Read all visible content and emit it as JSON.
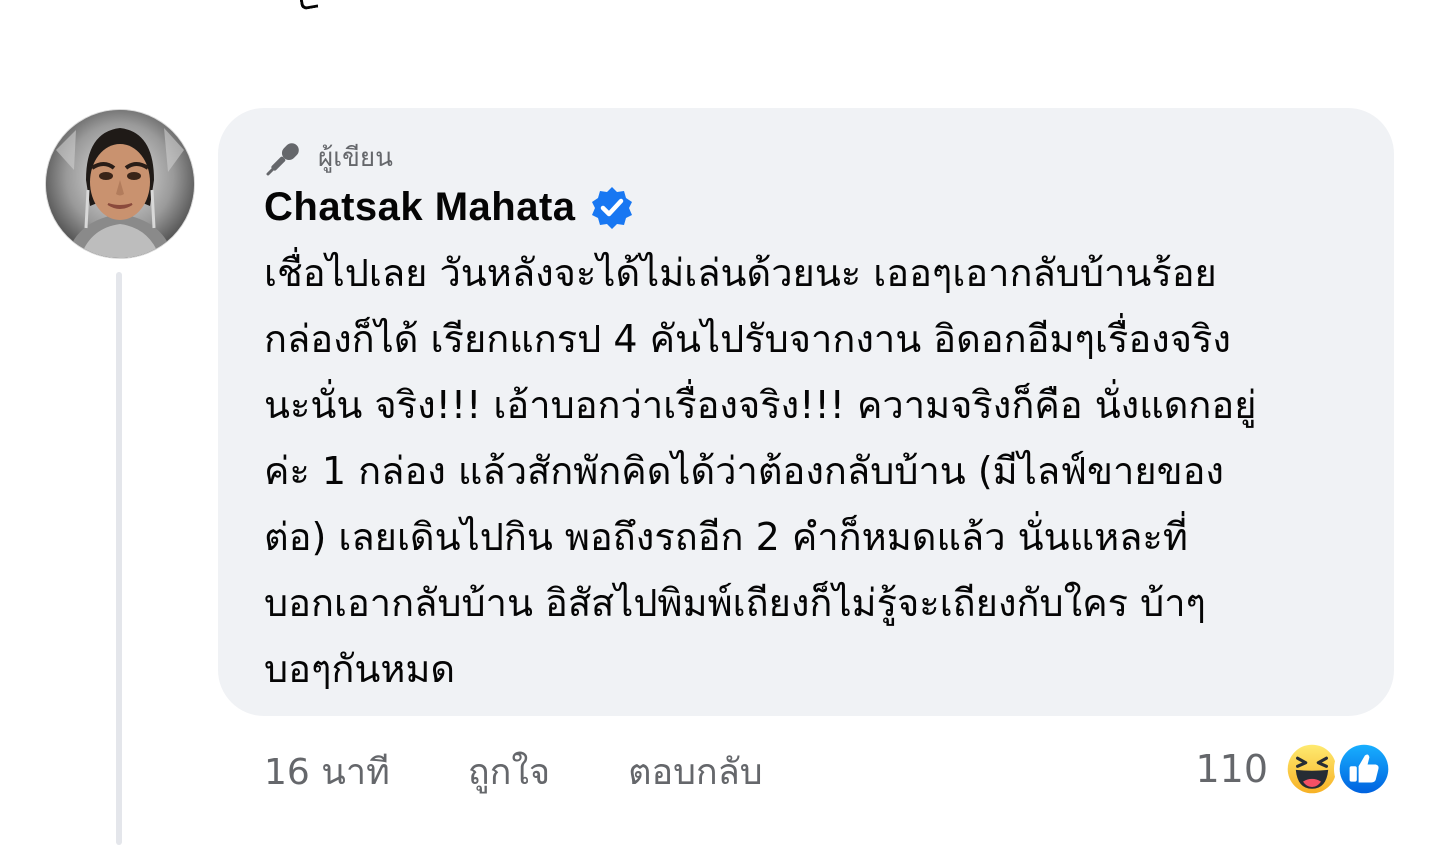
{
  "comment": {
    "author_badge": "ผู้เขียน",
    "author_name": "Chatsak Mahata",
    "text_lines": [
      "เชื่อไปเลย วันหลังจะได้ไม่เล่นด้วยนะ เออๆเอากลับบ้านร้อย",
      "กล่องก็ได้ เรียกแกรป 4 คันไปรับจากงาน อิดอกอีมๆเรื่องจริง",
      "นะนั่น จริง!!! เอ้าบอกว่าเรื่องจริง!!! ความจริงก็คือ นั่งแดกอยู่",
      "ค่ะ 1 กล่อง แล้วสักพักคิดได้ว่าต้องกลับบ้าน (มีไลฟ์ขายของ",
      "ต่อ) เลยเดินไปกิน พอถึงรถอีก 2 คำก็หมดแล้ว นั่นแหละที่",
      "บอกเอากลับบ้าน อิสัสไปพิมพ์เถียงก็ไม่รู้จะเถียงกับใคร บ้าๆ",
      "บอๆกันหมด"
    ]
  },
  "actions": {
    "time": "16 นาที",
    "like_label": "ถูกใจ",
    "reply_label": "ตอบกลับ"
  },
  "reactions": {
    "count": "110",
    "icons": [
      "haha-icon",
      "like-icon"
    ]
  },
  "colors": {
    "bubble": "#f0f2f5",
    "secondary_text": "#65676b",
    "primary_text": "#050505",
    "verified_blue": "#1877f2",
    "like_blue": "#1877f2",
    "haha_yellow": "#f7b125"
  }
}
